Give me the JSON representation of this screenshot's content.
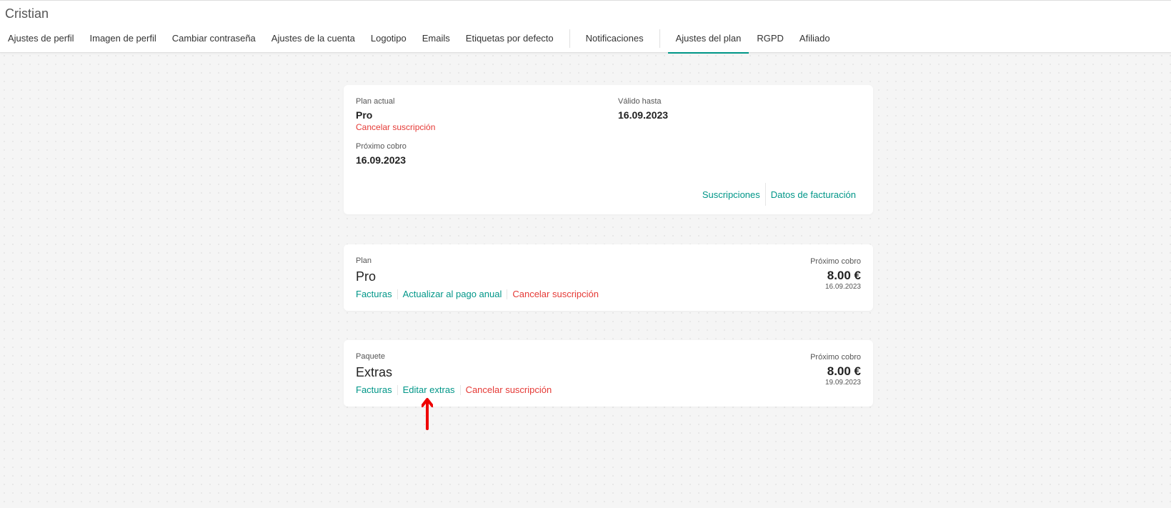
{
  "header": {
    "user_name": "Cristian",
    "tabs": [
      {
        "label": "Ajustes de perfil"
      },
      {
        "label": "Imagen de perfil"
      },
      {
        "label": "Cambiar contraseña"
      },
      {
        "label": "Ajustes de la cuenta"
      },
      {
        "label": "Logotipo"
      },
      {
        "label": "Emails"
      },
      {
        "label": "Etiquetas por defecto"
      },
      {
        "label": "Notificaciones"
      },
      {
        "label": "Ajustes del plan"
      },
      {
        "label": "RGPD"
      },
      {
        "label": "Afiliado"
      }
    ],
    "active_tab": "Ajustes del plan"
  },
  "current_plan": {
    "plan_label": "Plan actual",
    "plan_value": "Pro",
    "cancel_link": "Cancelar suscripción",
    "valid_label": "Válido hasta",
    "valid_value": "16.09.2023",
    "next_label": "Próximo cobro",
    "next_value": "16.09.2023",
    "subscriptions_link": "Suscripciones",
    "billing_link": "Datos de facturación"
  },
  "plan_card": {
    "label": "Plan",
    "title": "Pro",
    "links": {
      "invoices": "Facturas",
      "upgrade": "Actualizar al pago anual",
      "cancel": "Cancelar suscripción"
    },
    "next_label": "Próximo cobro",
    "amount": "8.00 €",
    "date": "16.09.2023"
  },
  "package_card": {
    "label": "Paquete",
    "title": "Extras",
    "links": {
      "invoices": "Facturas",
      "edit": "Editar extras",
      "cancel": "Cancelar suscripción"
    },
    "next_label": "Próximo cobro",
    "amount": "8.00 €",
    "date": "19.09.2023"
  },
  "colors": {
    "accent": "#009688",
    "danger": "#e53935",
    "annotation_arrow": "#ee0000"
  }
}
